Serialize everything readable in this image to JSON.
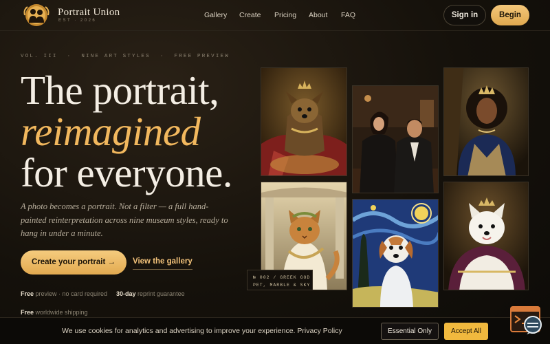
{
  "brand": {
    "name": "Portrait Union",
    "sub": "EST · 2026"
  },
  "nav": {
    "links": [
      "Gallery",
      "Create",
      "Pricing",
      "About",
      "FAQ"
    ],
    "signin": "Sign in",
    "begin": "Begin"
  },
  "hero": {
    "eyebrow": [
      "VOL. III",
      "·",
      "NINE ART STYLES",
      "·",
      "FREE PREVIEW"
    ],
    "line1": "The portrait,",
    "line2": "reimagined",
    "line3": "for everyone.",
    "lede": "A photo becomes a portrait. Not a filter — a full hand-painted reinterpretation across nine museum styles, ready to hang in under a minute.",
    "cta_primary": "Create your portrait →",
    "cta_secondary": "View the gallery",
    "perks": [
      {
        "strong": "Free",
        "rest": " preview · no card required"
      },
      {
        "strong": "30-day",
        "rest": " reprint guarantee"
      },
      {
        "strong": "Free",
        "rest": " worldwide shipping"
      }
    ]
  },
  "gallery": {
    "caption_line1": "№ 002 / GREEK GOD",
    "caption_line2": "PET, MARBLE & SKY",
    "tiles": [
      "yorkie-royal-portrait",
      "couple-noir-portrait",
      "queen-baroque-portrait",
      "cat-greek-god-portrait",
      "dog-starry-night-portrait",
      "samoyed-royal-portrait"
    ]
  },
  "cookie": {
    "text": "We use cookies for analytics and advertising to improve your experience. Privacy Policy",
    "essential": "Essential Only",
    "accept": "Accept All"
  },
  "colors": {
    "accent": "#f2b85e",
    "background": "#15110b",
    "accept": "#f1b93e"
  },
  "icons": {
    "chat": "chat-bubble-icon",
    "logo": "couple-silhouette-logo-icon"
  }
}
